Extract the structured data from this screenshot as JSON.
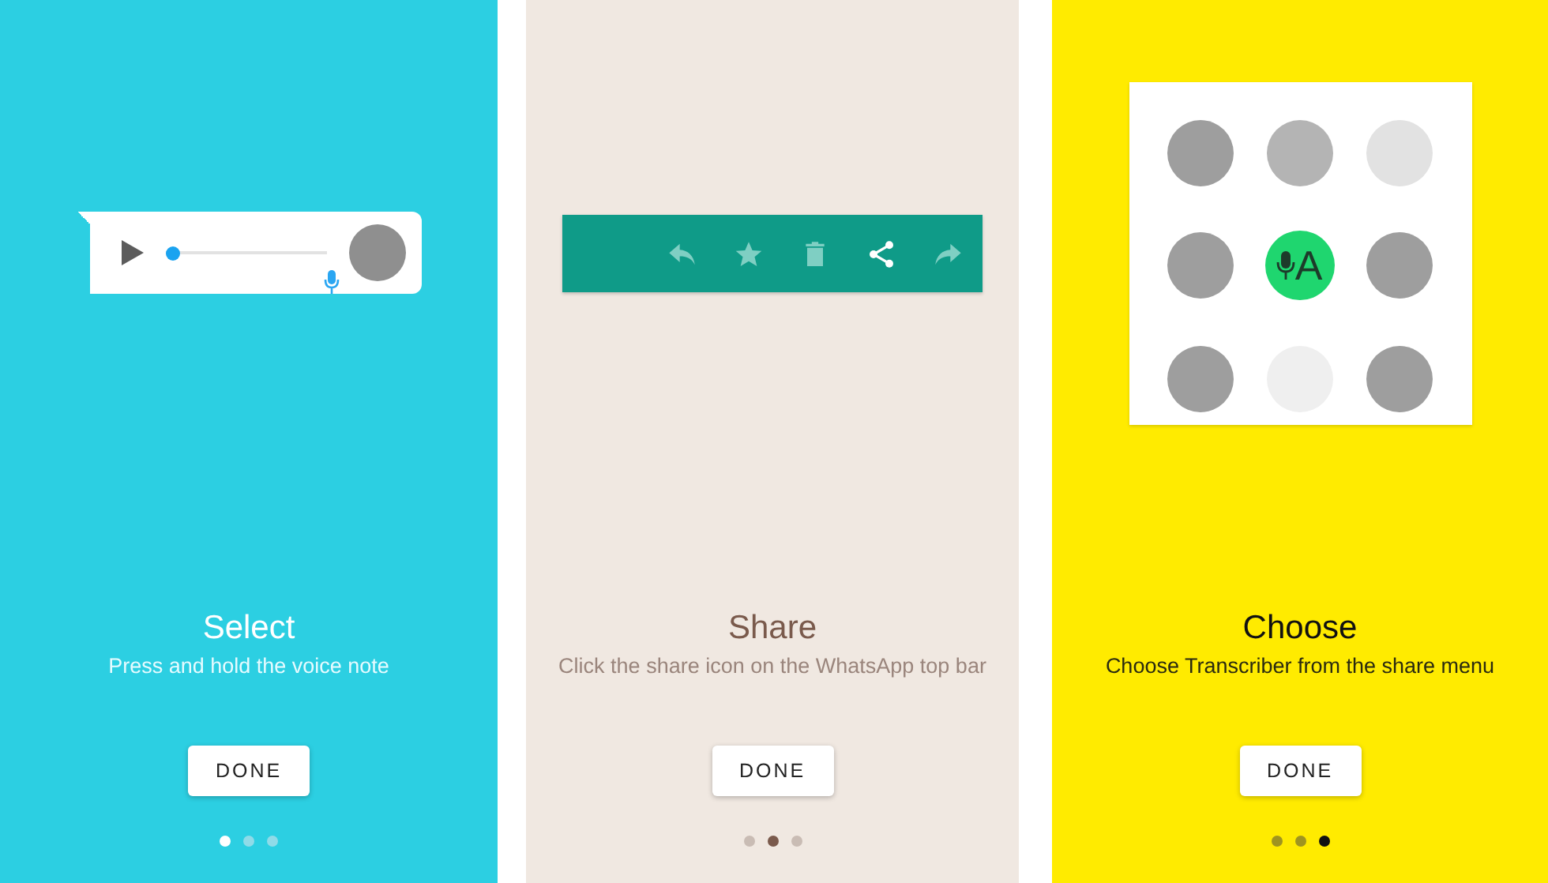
{
  "screens": [
    {
      "kind": "voice_note",
      "title": "Select",
      "subtitle": "Press and hold the voice note",
      "button": "DONE",
      "voice_note": {
        "level": 0
      },
      "pages": [
        {
          "selected": true
        },
        {
          "selected": false
        },
        {
          "selected": false
        }
      ]
    },
    {
      "kind": "toolbar",
      "title": "Share",
      "subtitle": "Click the share icon on the WhatsApp top bar",
      "button": "DONE",
      "actions": [
        {
          "kind": "reply",
          "selected": false
        },
        {
          "kind": "star",
          "selected": false
        },
        {
          "kind": "delete",
          "selected": false
        },
        {
          "kind": "share",
          "selected": true
        },
        {
          "kind": "forward",
          "selected": false
        }
      ],
      "pages": [
        {
          "selected": false
        },
        {
          "selected": true
        },
        {
          "selected": false
        }
      ]
    },
    {
      "kind": "app_grid",
      "title": "Choose",
      "subtitle": "Choose Transcriber from the share menu",
      "button": "DONE",
      "app_icon": {
        "label": "A"
      },
      "pages": [
        {
          "selected": false
        },
        {
          "selected": false
        },
        {
          "selected": true
        }
      ]
    }
  ]
}
